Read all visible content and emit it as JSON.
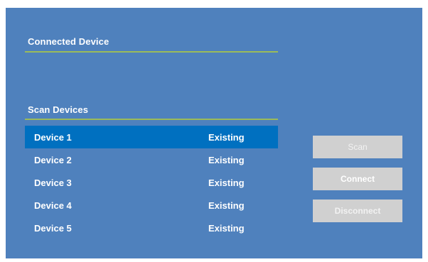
{
  "connected_section": {
    "title": "Connected Device"
  },
  "scan_section": {
    "title": "Scan Devices",
    "devices": [
      {
        "name": "Device 1",
        "status": "Existing",
        "selected": true
      },
      {
        "name": "Device 2",
        "status": "Existing",
        "selected": false
      },
      {
        "name": "Device 3",
        "status": "Existing",
        "selected": false
      },
      {
        "name": "Device 4",
        "status": "Existing",
        "selected": false
      },
      {
        "name": "Device 5",
        "status": "Existing",
        "selected": false
      }
    ]
  },
  "buttons": {
    "scan_label": "Scan",
    "connect_label": "Connect",
    "disconnect_label": "Disconnect"
  },
  "colors": {
    "panel_background": "#4f81bd",
    "selected_row": "#0070c0",
    "divider": "#9bbb59",
    "button_background": "#d0d0d0"
  }
}
